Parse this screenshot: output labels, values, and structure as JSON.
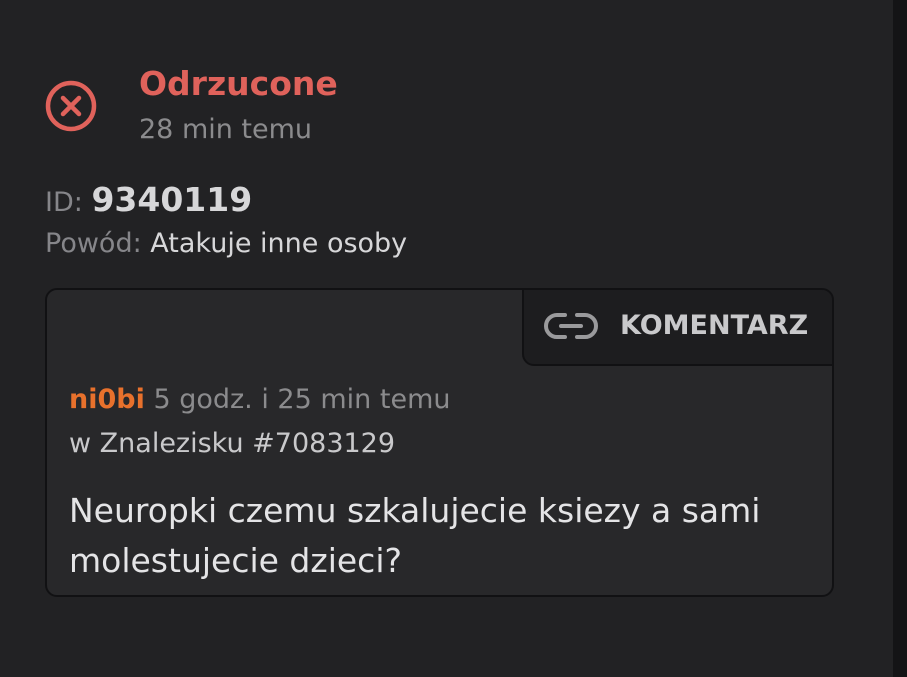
{
  "status": {
    "icon": "x-circle-icon",
    "title": "Odrzucone",
    "time": "28 min temu",
    "color": "#e0625b"
  },
  "details": {
    "id_label": "ID:",
    "id_value": "9340119",
    "reason_label": "Powód:",
    "reason_value": "Atakuje inne osoby"
  },
  "card": {
    "tab_icon": "link-icon",
    "tab_label": "KOMENTARZ",
    "author": "ni0bi",
    "author_color": "#e8712c",
    "time": "5 godz. i 25 min temu",
    "location": "w Znalezisku #7083129",
    "body": "Neuropki czemu szkalujecie ksiezy a sami molestujecie dzieci?"
  }
}
